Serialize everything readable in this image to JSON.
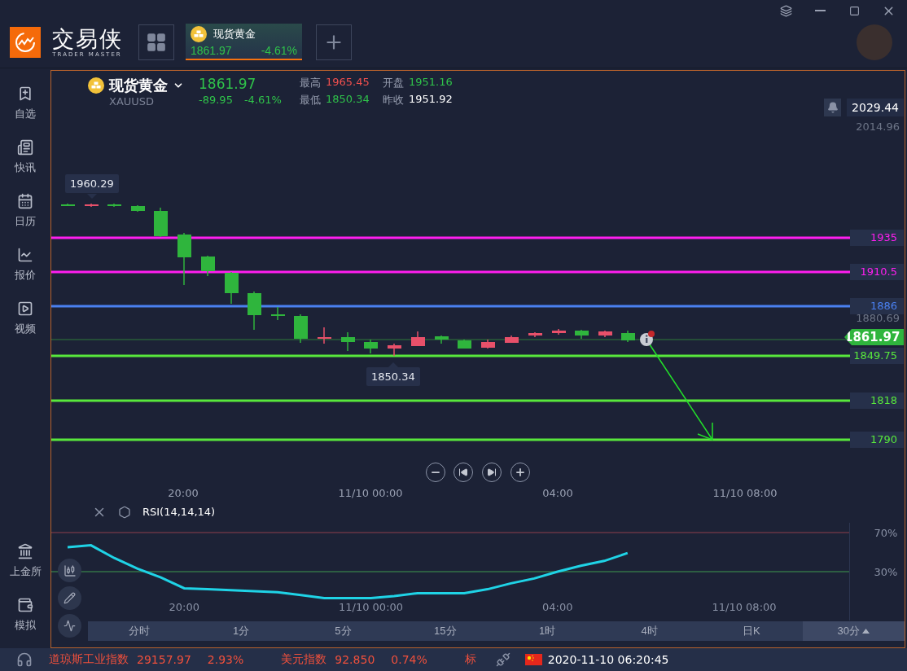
{
  "app": {
    "name": "交易侠",
    "tagline": "TRADER MASTER"
  },
  "tabs": [
    {
      "name": "现货黄金",
      "price": "1861.97",
      "change": "-4.61%",
      "selected": true
    }
  ],
  "sidebar": {
    "items": [
      {
        "label": "自选",
        "kind": "watchlist"
      },
      {
        "label": "快讯",
        "kind": "news"
      },
      {
        "label": "日历",
        "kind": "calendar"
      },
      {
        "label": "报价",
        "kind": "quotes"
      },
      {
        "label": "视频",
        "kind": "video"
      }
    ],
    "bottom_items": [
      {
        "label": "上金所",
        "kind": "exchange"
      },
      {
        "label": "模拟",
        "kind": "demo"
      }
    ]
  },
  "quote": {
    "name": "现货黄金",
    "symbol": "XAUUSD",
    "price": "1861.97",
    "change": "-89.95",
    "change_pct": "-4.61%",
    "stats": [
      {
        "label": "最高",
        "value": "1965.45",
        "color": "#f2504e"
      },
      {
        "label": "开盘",
        "value": "1951.16",
        "color": "#2fc24a"
      },
      {
        "label": "最低",
        "value": "1850.34",
        "color": "#2fc24a"
      },
      {
        "label": "昨收",
        "value": "1951.92",
        "color": "#ffffff"
      }
    ]
  },
  "price_scale": {
    "alert_price": "2029.44",
    "labels": [
      "2014.96",
      "1880.69"
    ]
  },
  "price_levels": [
    {
      "label": "1935",
      "color": "#ff1ef0"
    },
    {
      "label": "1910.5",
      "color": "#ff1ef0"
    },
    {
      "label": "1886",
      "color": "#4a80f0"
    },
    {
      "label": "1849.75",
      "color": "#58e83c"
    },
    {
      "label": "1818",
      "color": "#58e83c"
    },
    {
      "label": "1790",
      "color": "#58e83c"
    }
  ],
  "current_price": "1861.97",
  "markers": {
    "high": "1960.29",
    "low": "1850.34"
  },
  "time_axis": [
    "20:00",
    "11/10 00:00",
    "04:00",
    "11/10 08:00"
  ],
  "indicator": {
    "chart_data": {
      "type": "line",
      "categories": [
        null,
        null,
        null,
        null,
        null,
        "20:00",
        null,
        null,
        null,
        null,
        null,
        null,
        null,
        "11/10 00:00",
        null,
        null,
        null,
        null,
        null,
        null,
        null,
        "04:00",
        null,
        null,
        null,
        null,
        null,
        null,
        null,
        "11/10 08:00",
        null,
        null,
        null,
        null
      ],
      "series": [
        {
          "name": "RSI(14,14,14)",
          "color": "#1fd3e6",
          "values": [
            55,
            57,
            44,
            33,
            24,
            13,
            12,
            11,
            10,
            9,
            6,
            3,
            3,
            3,
            5,
            8,
            8,
            8,
            12,
            18,
            23,
            30,
            36,
            41,
            49,
            null,
            null,
            null,
            null,
            null,
            null,
            null,
            null,
            null
          ]
        }
      ],
      "ylim": [
        -20,
        80
      ],
      "yticks": [
        {
          "value": 70,
          "label": "70%"
        },
        {
          "value": 30,
          "label": "30%"
        }
      ],
      "ref_lines": [
        {
          "axis": "y",
          "value": 70,
          "color": "#8e3e4c"
        },
        {
          "axis": "y",
          "value": 30,
          "color": "#3f9a4f"
        }
      ]
    }
  },
  "timeframes": [
    {
      "label": "分时",
      "selected": false
    },
    {
      "label": "1分",
      "selected": false
    },
    {
      "label": "5分",
      "selected": false
    },
    {
      "label": "15分",
      "selected": false
    },
    {
      "label": "1时",
      "selected": false
    },
    {
      "label": "4时",
      "selected": false
    },
    {
      "label": "日K",
      "selected": false
    },
    {
      "label": "30分",
      "selected": true
    }
  ],
  "status_bar": {
    "tickers": [
      {
        "name": "道琼斯工业指数",
        "value": "29157.97",
        "change": "2.93%"
      },
      {
        "name": "美元指数",
        "value": "92.850",
        "change": "0.74%"
      },
      {
        "name": "标"
      }
    ],
    "datetime": "2020-11-10 06:20:45"
  }
}
